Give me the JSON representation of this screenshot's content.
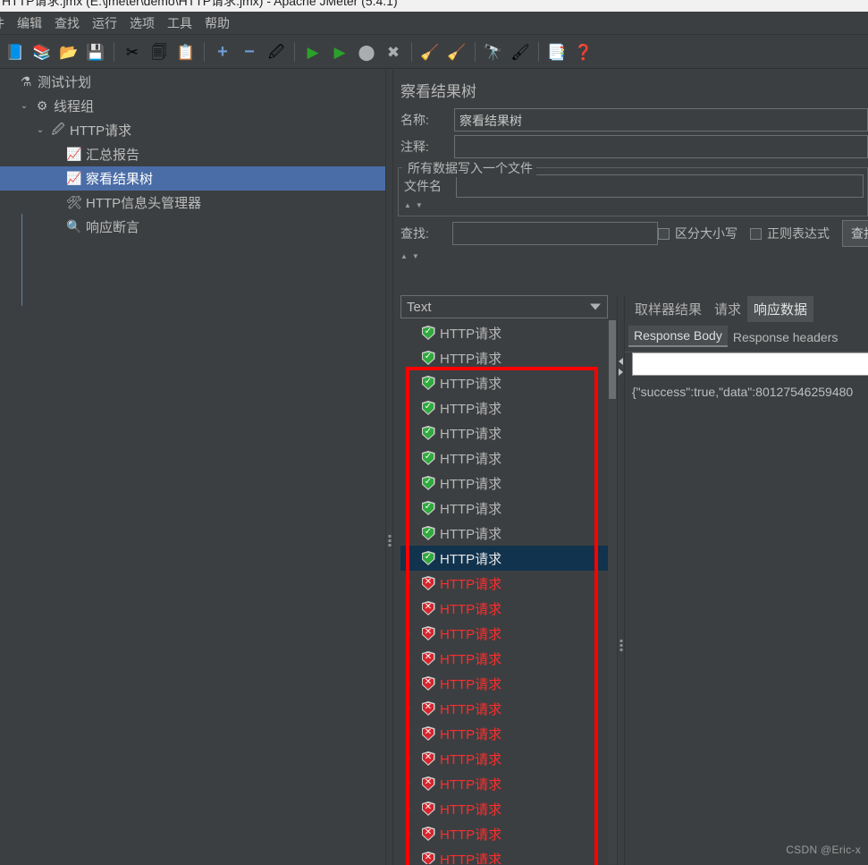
{
  "window": {
    "title": "HTTP请求.jmx (E:\\jmeter\\demo\\HTTP请求.jmx) - Apache JMeter (5.4.1)"
  },
  "menubar": {
    "items": [
      {
        "label": "件",
        "name": "menu-file"
      },
      {
        "label": "编辑",
        "name": "menu-edit"
      },
      {
        "label": "查找",
        "name": "menu-search"
      },
      {
        "label": "运行",
        "name": "menu-run"
      },
      {
        "label": "选项",
        "name": "menu-options"
      },
      {
        "label": "工具",
        "name": "menu-tools"
      },
      {
        "label": "帮助",
        "name": "menu-help"
      }
    ]
  },
  "toolbar": {
    "buttons": [
      {
        "name": "new-test-plan-icon",
        "glyph": "📘"
      },
      {
        "name": "templates-icon",
        "glyph": "📚"
      },
      {
        "name": "open-icon",
        "glyph": "📂"
      },
      {
        "name": "save-icon",
        "glyph": "💾"
      },
      {
        "sep": true
      },
      {
        "name": "cut-icon",
        "glyph": "✂"
      },
      {
        "name": "copy-icon",
        "glyph": "🗐"
      },
      {
        "name": "paste-icon",
        "glyph": "📋"
      },
      {
        "sep": true
      },
      {
        "name": "expand-all-icon",
        "glyph": "+"
      },
      {
        "name": "collapse-all-icon",
        "glyph": "−"
      },
      {
        "name": "toggle-icon",
        "glyph": "🖉"
      },
      {
        "sep": true
      },
      {
        "name": "start-icon",
        "glyph": "▶"
      },
      {
        "name": "start-no-pauses-icon",
        "glyph": "▶"
      },
      {
        "name": "stop-icon",
        "glyph": "⬤"
      },
      {
        "name": "shutdown-icon",
        "glyph": "✖"
      },
      {
        "sep": true
      },
      {
        "name": "clear-icon",
        "glyph": "🧹"
      },
      {
        "name": "clear-all-icon",
        "glyph": "🧹"
      },
      {
        "sep": true
      },
      {
        "name": "search-icon",
        "glyph": "🔭"
      },
      {
        "name": "reset-search-icon",
        "glyph": "🖌"
      },
      {
        "sep": true
      },
      {
        "name": "function-helper-icon",
        "glyph": "📑"
      },
      {
        "name": "help-icon",
        "glyph": "❓"
      }
    ]
  },
  "tree": {
    "nodes": [
      {
        "label": "测试计划",
        "icon": "flask-icon",
        "glyph": "⚗",
        "indent": 0,
        "twisty": "",
        "selected": false,
        "name": "tree-node-test-plan"
      },
      {
        "label": "线程组",
        "icon": "gear-icon",
        "glyph": "⚙",
        "indent": 1,
        "twisty": "⌄",
        "selected": false,
        "name": "tree-node-thread-group"
      },
      {
        "label": "HTTP请求",
        "icon": "pencil-icon",
        "glyph": "🖉",
        "indent": 2,
        "twisty": "⌄",
        "selected": false,
        "name": "tree-node-http-request"
      },
      {
        "label": "汇总报告",
        "icon": "chart-icon",
        "glyph": "📈",
        "indent": 3,
        "twisty": "",
        "selected": false,
        "name": "tree-node-summary-report"
      },
      {
        "label": "察看结果树",
        "icon": "chart-icon",
        "glyph": "📈",
        "indent": 3,
        "twisty": "",
        "selected": true,
        "name": "tree-node-view-results-tree"
      },
      {
        "label": "HTTP信息头管理器",
        "icon": "wrench-icon",
        "glyph": "🛠",
        "indent": 3,
        "twisty": "",
        "selected": false,
        "name": "tree-node-http-header-manager"
      },
      {
        "label": "响应断言",
        "icon": "magnifier-icon",
        "glyph": "🔍",
        "indent": 3,
        "twisty": "",
        "selected": false,
        "name": "tree-node-response-assertion"
      }
    ]
  },
  "panel": {
    "title": "察看结果树",
    "name_label": "名称:",
    "name_value": "察看结果树",
    "comment_label": "注释:",
    "comment_value": "",
    "filegroup_legend": "所有数据写入一个文件",
    "filename_label": "文件名",
    "filename_value": "",
    "search_label": "查找:",
    "search_value": "",
    "case_sensitive_label": "区分大小写",
    "regex_label": "正则表达式",
    "search_button": "查找",
    "renderer_selected": "Text"
  },
  "results": {
    "rows": [
      {
        "label": "HTTP请求",
        "status": "ok",
        "twisty": "",
        "selected": false
      },
      {
        "label": "HTTP请求",
        "status": "ok",
        "twisty": "",
        "selected": false
      },
      {
        "label": "HTTP请求",
        "status": "ok",
        "twisty": "",
        "selected": false
      },
      {
        "label": "HTTP请求",
        "status": "ok",
        "twisty": "",
        "selected": false
      },
      {
        "label": "HTTP请求",
        "status": "ok",
        "twisty": "",
        "selected": false
      },
      {
        "label": "HTTP请求",
        "status": "ok",
        "twisty": "",
        "selected": false
      },
      {
        "label": "HTTP请求",
        "status": "ok",
        "twisty": "",
        "selected": false
      },
      {
        "label": "HTTP请求",
        "status": "ok",
        "twisty": "",
        "selected": false
      },
      {
        "label": "HTTP请求",
        "status": "ok",
        "twisty": "",
        "selected": false
      },
      {
        "label": "HTTP请求",
        "status": "ok",
        "twisty": "",
        "selected": true
      },
      {
        "label": "HTTP请求",
        "status": "fail",
        "twisty": "›",
        "selected": false
      },
      {
        "label": "HTTP请求",
        "status": "fail",
        "twisty": "›",
        "selected": false
      },
      {
        "label": "HTTP请求",
        "status": "fail",
        "twisty": "›",
        "selected": false
      },
      {
        "label": "HTTP请求",
        "status": "fail",
        "twisty": "›",
        "selected": false
      },
      {
        "label": "HTTP请求",
        "status": "fail",
        "twisty": "›",
        "selected": false
      },
      {
        "label": "HTTP请求",
        "status": "fail",
        "twisty": "›",
        "selected": false
      },
      {
        "label": "HTTP请求",
        "status": "fail",
        "twisty": "›",
        "selected": false
      },
      {
        "label": "HTTP请求",
        "status": "fail",
        "twisty": "›",
        "selected": false
      },
      {
        "label": "HTTP请求",
        "status": "fail",
        "twisty": "›",
        "selected": false
      },
      {
        "label": "HTTP请求",
        "status": "fail",
        "twisty": "›",
        "selected": false
      },
      {
        "label": "HTTP请求",
        "status": "fail",
        "twisty": "›",
        "selected": false
      },
      {
        "label": "HTTP请求",
        "status": "fail",
        "twisty": "›",
        "selected": false
      }
    ]
  },
  "detail": {
    "tabs": [
      {
        "label": "取样器结果",
        "active": false,
        "name": "tab-sampler-result"
      },
      {
        "label": "请求",
        "active": false,
        "name": "tab-request"
      },
      {
        "label": "响应数据",
        "active": true,
        "name": "tab-response-data"
      }
    ],
    "subtabs": [
      {
        "label": "Response Body",
        "active": true,
        "name": "subtab-response-body"
      },
      {
        "label": "Response headers",
        "active": false,
        "name": "subtab-response-headers"
      }
    ],
    "search_field_value": "",
    "body_text": "{\"success\":true,\"data\":80127546259480"
  },
  "watermark": "CSDN @Eric-x",
  "colors": {
    "window_bg": "#3c3f41",
    "tree_selection": "#4a6da7",
    "list_selection": "#11334d",
    "annotation_red": "#ff0000",
    "fail_text": "#ff2c2c",
    "success_green": "#2faa3d",
    "fail_red": "#d6252c"
  }
}
